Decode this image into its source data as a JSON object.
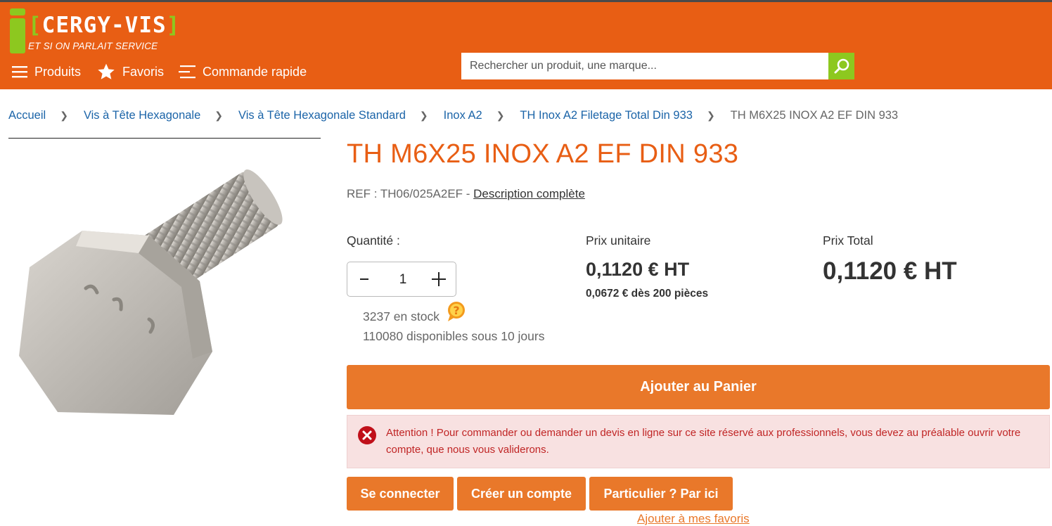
{
  "brand": {
    "name": "CERGY-VIS",
    "bracket_open": "[",
    "bracket_close": "]",
    "tagline": "ET SI ON PARLAIT SERVICE",
    "colors": {
      "primary": "#e85e14",
      "accent": "#8dc81f",
      "button": "#e9782a"
    }
  },
  "nav": {
    "items": [
      {
        "label": "Produits",
        "icon": "hamburger-icon"
      },
      {
        "label": "Favoris",
        "icon": "star-icon"
      },
      {
        "label": "Commande rapide",
        "icon": "list-icon"
      }
    ]
  },
  "search": {
    "placeholder": "Rechercher un produit, une marque...",
    "icon": "search-icon"
  },
  "breadcrumb": [
    "Accueil",
    "Vis à Tête Hexagonale",
    "Vis à Tête Hexagonale Standard",
    "Inox A2",
    "TH Inox A2 Filetage Total Din 933",
    "TH M6X25 INOX A2 EF DIN 933"
  ],
  "product": {
    "title": "TH M6X25 INOX A2 EF DIN 933",
    "ref_text": "REF : TH06/025A2EF -",
    "description_link": "Description complète",
    "quantity_label": "Quantité :",
    "quantity_value": "1",
    "stock": "3237 en stock",
    "availability": "110080 disponibles sous 10 jours",
    "unit_price_label": "Prix unitaire",
    "unit_price": "0,1120 € HT",
    "volume_price": "0,0672 € dès 200 pièces",
    "total_price_label": "Prix Total",
    "total_price": "0,1120 € HT"
  },
  "actions": {
    "add_to_cart": "Ajouter au Panier",
    "alert": "Attention ! Pour commander ou demander un devis en ligne sur ce site réservé aux professionnels, vous devez au préalable ouvrir votre compte, que nous vous validerons.",
    "login": "Se connecter",
    "create_account": "Créer un compte",
    "individual": "Particulier ? Par ici",
    "add_to_favorites": "Ajouter à mes favoris"
  }
}
